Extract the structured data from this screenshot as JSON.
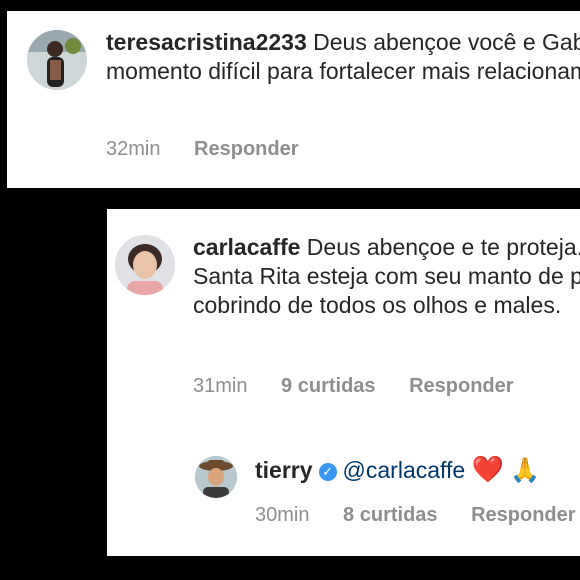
{
  "comments": [
    {
      "username": "teresacristina2233",
      "text": " Deus abençoe você e Gabi existe momento difícil para fortalecer mais relacionamento",
      "time": "32min",
      "reply_label": "Responder"
    },
    {
      "username": "carlacaffe",
      "text": " Deus abençoe e te proteja. Que nossa Santa Rita esteja com seu manto de proteção te cobrindo de todos os olhos e males.",
      "time": "31min",
      "likes": "9 curtidas",
      "reply_label": "Responder"
    }
  ],
  "reply": {
    "username": "tierry",
    "verified_icon": "verified-badge-icon",
    "mention": "@carlacaffe",
    "emojis": [
      "❤️",
      "🙏"
    ],
    "time": "30min",
    "likes": "8 curtidas",
    "reply_label": "Responder"
  },
  "colors": {
    "background": "#000000",
    "card": "#ffffff",
    "text": "#262626",
    "meta": "#8e8e8e",
    "mention": "#00376b",
    "verified": "#3897f0",
    "heart": "#e0245e"
  }
}
